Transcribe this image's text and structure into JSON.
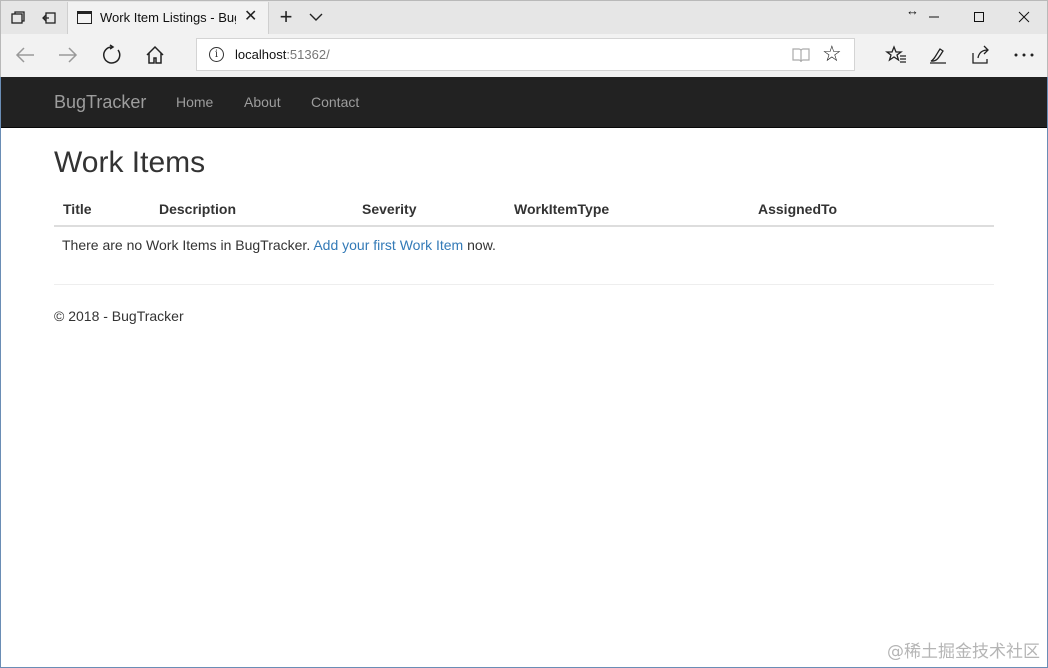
{
  "browser": {
    "tab_title": "Work Item Listings - BugTracker",
    "url_host": "localhost",
    "url_port": ":51362/",
    "window_controls": [
      "minimize-icon",
      "maximize-icon",
      "close-icon"
    ],
    "toolbar_icons": [
      "favorites-list-icon",
      "pen-icon",
      "share-icon",
      "more-icon"
    ]
  },
  "site": {
    "brand": "BugTracker",
    "nav": [
      {
        "label": "Home"
      },
      {
        "label": "About"
      },
      {
        "label": "Contact"
      }
    ]
  },
  "main": {
    "title": "Work Items",
    "columns": [
      "Title",
      "Description",
      "Severity",
      "WorkItemType",
      "AssignedTo"
    ],
    "empty_prefix": "There are no Work Items in BugTracker. ",
    "empty_link": "Add your first Work Item",
    "empty_suffix": " now."
  },
  "footer": {
    "text": "© 2018 - BugTracker"
  },
  "watermark": "@稀土掘金技术社区",
  "colors": {
    "navbar_bg": "#222222",
    "nav_text": "#9d9d9d",
    "link": "#337ab7"
  }
}
